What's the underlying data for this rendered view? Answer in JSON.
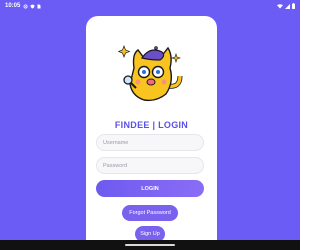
{
  "status_bar": {
    "time": "10:05",
    "icons": [
      "settings-icon",
      "shield-icon",
      "sim-icon"
    ],
    "right_icons": [
      "wifi-icon",
      "signal-icon",
      "battery-icon"
    ]
  },
  "login": {
    "title": "FINDEE | LOGIN",
    "mascot": "cat-mascot-icon",
    "username_placeholder": "Username",
    "password_placeholder": "Password",
    "login_label": "LOGIN",
    "forgot_label": "Forgot Password",
    "signup_label": "Sign Up"
  },
  "colors": {
    "background": "#6b5cf6",
    "accent": "#5b50e8",
    "button": "#7b62ee",
    "mascot": "#f9c320"
  }
}
